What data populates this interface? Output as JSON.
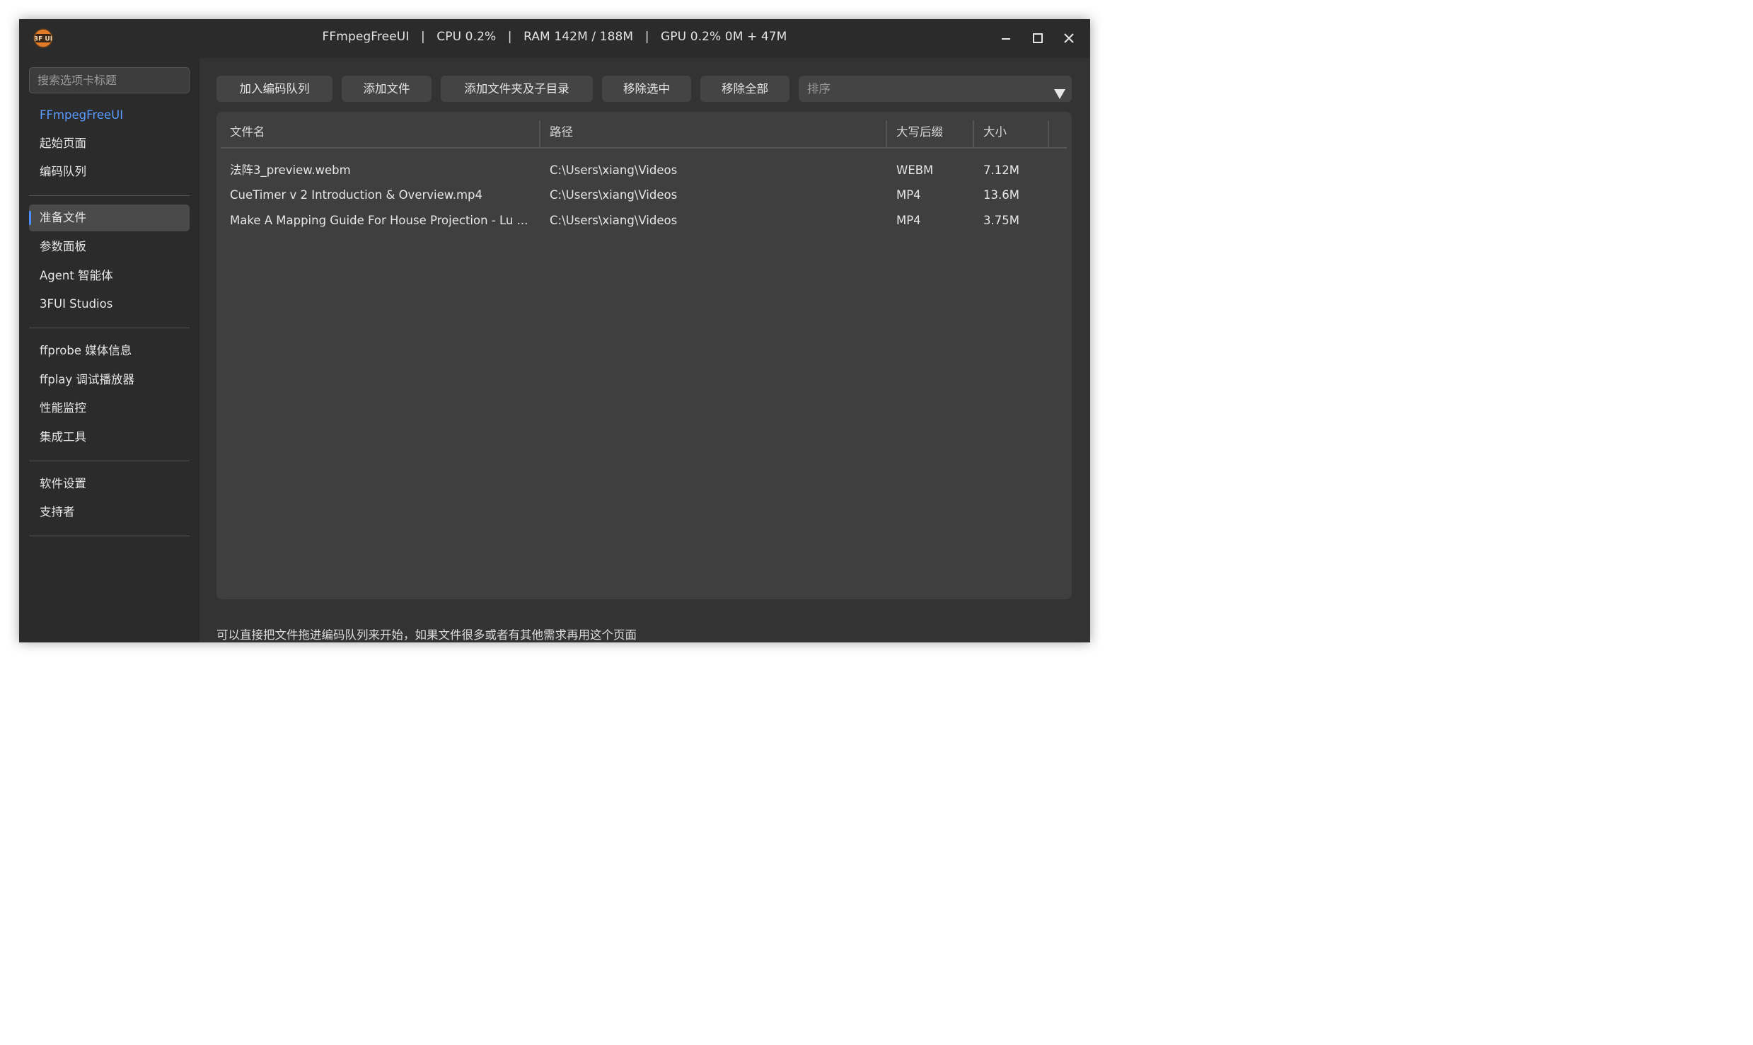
{
  "titlebar": {
    "title": "FFmpegFreeUI   |   CPU 0.2%   |   RAM 142M / 188M   |   GPU 0.2% 0M + 47M",
    "logo_icon": "3fui-logo-icon",
    "logo_text": "3F UI",
    "controls": [
      "minimize-icon",
      "maximize-icon",
      "close-icon"
    ]
  },
  "sidebar": {
    "search_placeholder": "搜索选项卡标题",
    "groups": [
      [
        {
          "label": "FFmpegFreeUI",
          "brand": true
        },
        {
          "label": "起始页面"
        },
        {
          "label": "编码队列"
        }
      ],
      [
        {
          "label": "准备文件",
          "active": true
        },
        {
          "label": "参数面板"
        },
        {
          "label": "Agent 智能体"
        },
        {
          "label": "3FUI Studios"
        }
      ],
      [
        {
          "label": "ffprobe 媒体信息"
        },
        {
          "label": "ffplay 调试播放器"
        },
        {
          "label": "性能监控"
        },
        {
          "label": "集成工具"
        }
      ],
      [
        {
          "label": "软件设置"
        },
        {
          "label": "支持者"
        }
      ]
    ]
  },
  "toolbar": {
    "add_to_queue": "加入编码队列",
    "add_files": "添加文件",
    "add_folder": "添加文件夹及子目录",
    "remove_selected": "移除选中",
    "remove_all": "移除全部",
    "sort_placeholder": "排序"
  },
  "table": {
    "columns": [
      "文件名",
      "路径",
      "大写后缀",
      "大小"
    ],
    "rows": [
      [
        "法阵3_preview.webm",
        "C:\\Users\\xiang\\Videos",
        "WEBM",
        "7.12M"
      ],
      [
        "CueTimer v 2 Introduction & Overview.mp4",
        "C:\\Users\\xiang\\Videos",
        "MP4",
        "13.6M"
      ],
      [
        "Make A Mapping Guide For House Projection - Lu ...",
        "C:\\Users\\xiang\\Videos",
        "MP4",
        "3.75M"
      ]
    ]
  },
  "hint": "可以直接把文件拖进编码队列来开始，如果文件很多或者有其他需求再用这个页面",
  "colors": {
    "window_bg": "#2b2b2b",
    "main_bg": "#333333",
    "panel_bg": "#3f3f3f",
    "button_bg": "#444444",
    "accent": "#4a8eff",
    "brand_text": "#5b9bff",
    "logo_orange": "#e07b2a"
  }
}
